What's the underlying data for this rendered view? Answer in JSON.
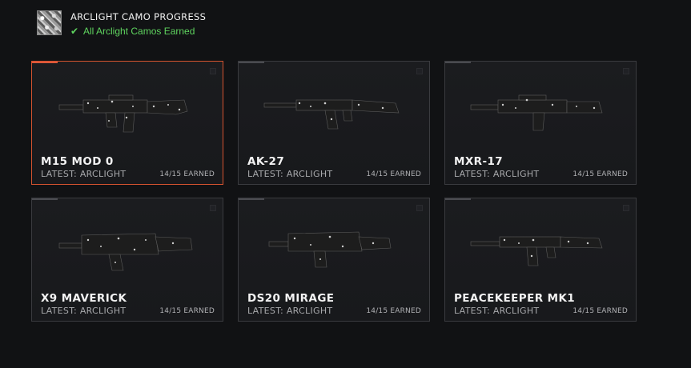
{
  "header": {
    "title": "ARCLIGHT CAMO PROGRESS",
    "status_icon": "check-icon",
    "status": "All Arclight Camos Earned",
    "status_color": "#5fd35f"
  },
  "accent_color": "#d4532f",
  "cards": [
    {
      "name": "M15 MOD 0",
      "latest": "LATEST: ARCLIGHT",
      "earned": "14/15 EARNED",
      "selected": true
    },
    {
      "name": "AK-27",
      "latest": "LATEST: ARCLIGHT",
      "earned": "14/15 EARNED",
      "selected": false
    },
    {
      "name": "MXR-17",
      "latest": "LATEST: ARCLIGHT",
      "earned": "14/15 EARNED",
      "selected": false
    },
    {
      "name": "X9 MAVERICK",
      "latest": "LATEST: ARCLIGHT",
      "earned": "14/15 EARNED",
      "selected": false
    },
    {
      "name": "DS20 MIRAGE",
      "latest": "LATEST: ARCLIGHT",
      "earned": "14/15 EARNED",
      "selected": false
    },
    {
      "name": "PEACEKEEPER MK1",
      "latest": "LATEST: ARCLIGHT",
      "earned": "14/15 EARNED",
      "selected": false
    }
  ]
}
